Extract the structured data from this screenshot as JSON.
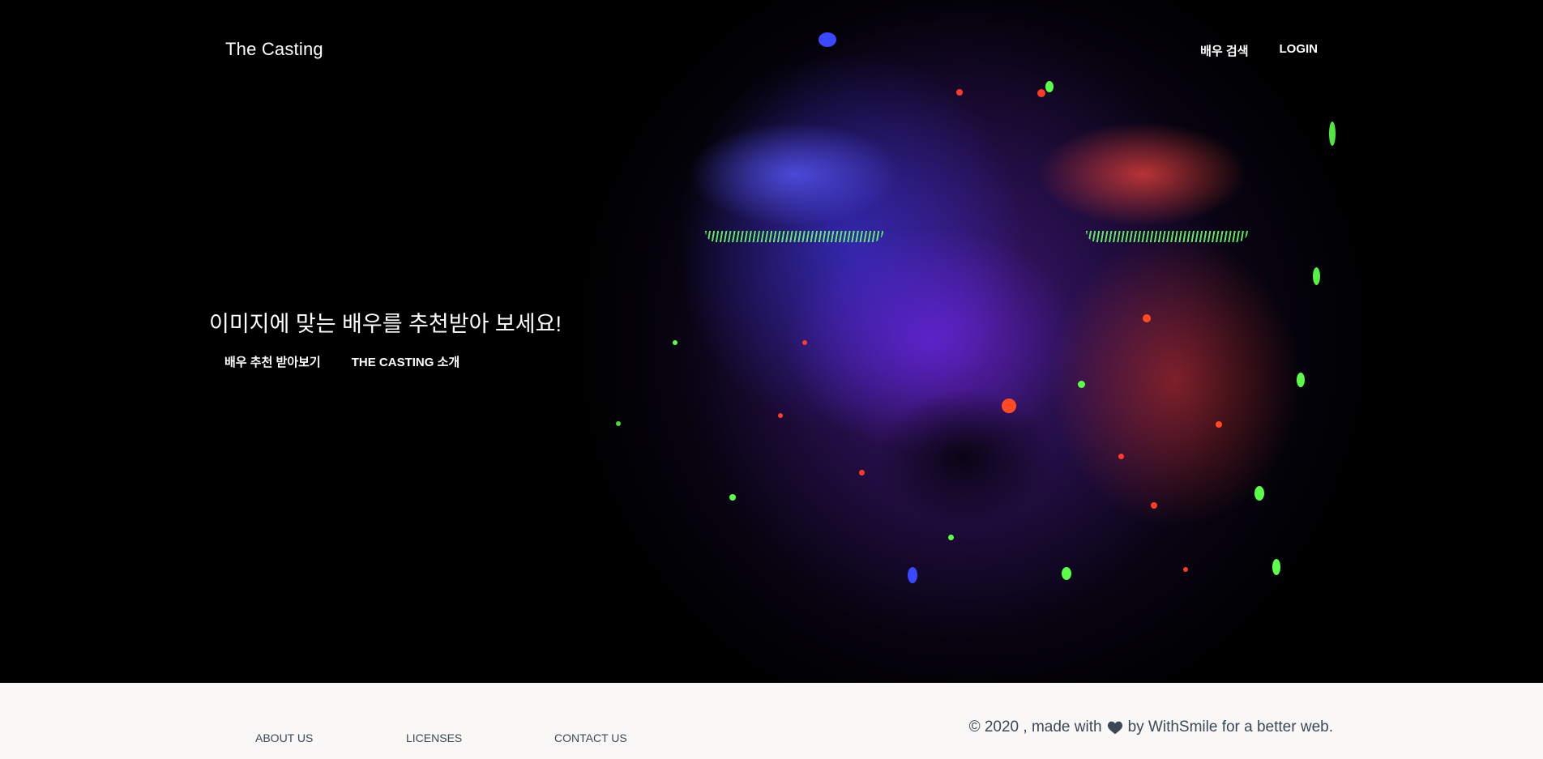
{
  "brand": "The Casting",
  "nav": {
    "items": [
      {
        "label": "배우 검색"
      },
      {
        "label": "LOGIN"
      }
    ]
  },
  "hero": {
    "headline": "이미지에 맞는 배우를 추천받아 보세요!",
    "actions": [
      {
        "label": "배우 추천 받아보기"
      },
      {
        "label": "THE CASTING 소개"
      }
    ],
    "image": "neon-painted-face-photo"
  },
  "footer": {
    "links": [
      {
        "label": "ABOUT US"
      },
      {
        "label": "LICENSES"
      },
      {
        "label": "CONTACT US"
      }
    ],
    "copyright_prefix": "© 2020 , made with",
    "copyright_suffix": "by WithSmile for a better web.",
    "heart_icon": "heart-icon",
    "text_color": "#3c4858",
    "background": "#f9f8f6"
  }
}
